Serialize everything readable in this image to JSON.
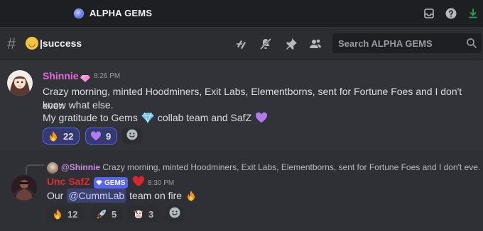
{
  "app": {
    "server_name": "ALPHA GEMS"
  },
  "channel": {
    "name": "|success",
    "emoji": "😌",
    "search_placeholder": "Search ALPHA GEMS"
  },
  "titlebar_icons": [
    "inbox-icon",
    "help-icon",
    "download-icon"
  ],
  "header_icons": [
    "threads-icon",
    "mute-icon",
    "pin-icon",
    "members-icon"
  ],
  "colors": {
    "accent": "#5865f2",
    "username_shinnie": "#e36ad9",
    "username_safz": "#e02c2c",
    "download_green": "#23a55a"
  },
  "messages": [
    {
      "username": "Shinnie",
      "timestamp": "8:26 PM",
      "lines": [
        "Crazy morning, minted Hoodminers, Exit Labs, Elementborns, sent for Fortune Foes and I don't even",
        "know what else."
      ],
      "line3_before": "My gratitude to Gems",
      "line3_after": "collab team and SafZ",
      "reactions": [
        {
          "emoji": "🔥",
          "count": "22",
          "me": true
        },
        {
          "emoji": "💜",
          "count": "9",
          "me": true
        }
      ]
    },
    {
      "reply": {
        "username": "@Shinnie",
        "text": "Crazy morning, minted Hoodminers, Exit Labs, Elementborns, sent for Fortune Foes and I don't eve..."
      },
      "username": "Unc SafZ",
      "tag": "GEMS",
      "timestamp": "8:30 PM",
      "text_before": "Our",
      "mention": "@CummLab",
      "text_after": "team on fire",
      "reactions": [
        {
          "emoji": "🔥",
          "count": "12",
          "me": false
        },
        {
          "emoji": "🚀",
          "count": "5",
          "me": false
        },
        {
          "emoji": "🐮",
          "count": "3",
          "me": false
        }
      ]
    }
  ]
}
